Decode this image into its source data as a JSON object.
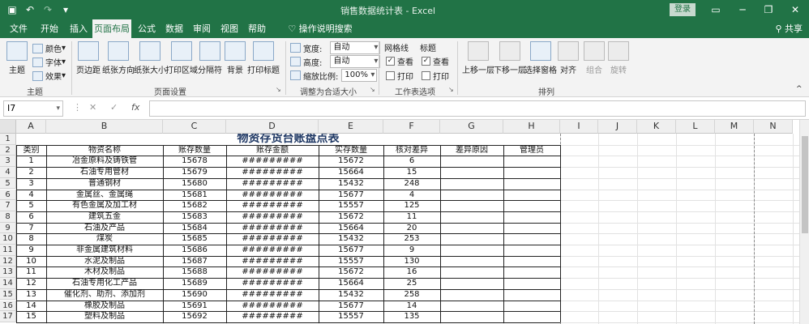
{
  "window": {
    "title": "销售数据统计表 - Excel",
    "login": "登录"
  },
  "tabs": [
    "文件",
    "开始",
    "插入",
    "页面布局",
    "公式",
    "数据",
    "审阅",
    "视图",
    "帮助",
    "操作说明搜索"
  ],
  "share": "共享",
  "ribbon": {
    "theme": {
      "main": "主题",
      "colors": "颜色",
      "fonts": "字体",
      "effects": "效果",
      "group": "主题"
    },
    "page_setup": {
      "margins": "页边距",
      "orientation": "纸张方向",
      "size": "纸张大小",
      "print_area": "打印区域",
      "breaks": "分隔符",
      "background": "背景",
      "print_titles": "打印标题",
      "group": "页面设置"
    },
    "scale": {
      "width_label": "宽度:",
      "width_value": "自动",
      "height_label": "高度:",
      "height_value": "自动",
      "scale_label": "缩放比例:",
      "scale_value": "100%",
      "group": "调整为合适大小"
    },
    "sheet_options": {
      "gridlines": "网格线",
      "headings": "标题",
      "view1": "查看",
      "view2": "查看",
      "print1": "打印",
      "print2": "打印",
      "group": "工作表选项"
    },
    "arrange": {
      "forward": "上移一层",
      "backward": "下移一层",
      "selection": "选择窗格",
      "align": "对齐",
      "group_btn": "组合",
      "rotate": "旋转",
      "group": "排列"
    }
  },
  "formula_bar": {
    "name_box": "I7",
    "fx": "fx",
    "value": ""
  },
  "columns": [
    "A",
    "B",
    "C",
    "D",
    "E",
    "F",
    "G",
    "H",
    "I",
    "J",
    "K",
    "L",
    "M",
    "N"
  ],
  "sheet": {
    "title": "物资存货台账盘点表",
    "headers": [
      "类别",
      "物资名称",
      "账存数量",
      "账存金额",
      "实存数量",
      "核对差异",
      "差异原因",
      "管理员"
    ],
    "rows": [
      {
        "row": "3",
        "cells": [
          "1",
          "冶金原料及铸铁管",
          "15678",
          "#########",
          "15672",
          "6",
          "",
          ""
        ]
      },
      {
        "row": "4",
        "cells": [
          "2",
          "石油专用管材",
          "15679",
          "#########",
          "15664",
          "15",
          "",
          ""
        ]
      },
      {
        "row": "5",
        "cells": [
          "3",
          "普通钢材",
          "15680",
          "#########",
          "15432",
          "248",
          "",
          ""
        ]
      },
      {
        "row": "6",
        "cells": [
          "4",
          "金属丝、金属绳",
          "15681",
          "#########",
          "15677",
          "4",
          "",
          ""
        ]
      },
      {
        "row": "7",
        "cells": [
          "5",
          "有色金属及加工材",
          "15682",
          "#########",
          "15557",
          "125",
          "",
          ""
        ]
      },
      {
        "row": "8",
        "cells": [
          "6",
          "建筑五金",
          "15683",
          "#########",
          "15672",
          "11",
          "",
          ""
        ]
      },
      {
        "row": "9",
        "cells": [
          "7",
          "石油及产品",
          "15684",
          "#########",
          "15664",
          "20",
          "",
          ""
        ]
      },
      {
        "row": "10",
        "cells": [
          "8",
          "煤炭",
          "15685",
          "#########",
          "15432",
          "253",
          "",
          ""
        ]
      },
      {
        "row": "11",
        "cells": [
          "9",
          "非金属建筑材料",
          "15686",
          "#########",
          "15677",
          "9",
          "",
          ""
        ]
      },
      {
        "row": "12",
        "cells": [
          "10",
          "水泥及制品",
          "15687",
          "#########",
          "15557",
          "130",
          "",
          ""
        ]
      },
      {
        "row": "13",
        "cells": [
          "11",
          "木材及制品",
          "15688",
          "#########",
          "15672",
          "16",
          "",
          ""
        ]
      },
      {
        "row": "14",
        "cells": [
          "12",
          "石油专用化工产品",
          "15689",
          "#########",
          "15664",
          "25",
          "",
          ""
        ]
      },
      {
        "row": "15",
        "cells": [
          "13",
          "催化剂、助剂、添加剂",
          "15690",
          "#########",
          "15432",
          "258",
          "",
          ""
        ]
      },
      {
        "row": "16",
        "cells": [
          "14",
          "橡胶及制品",
          "15691",
          "#########",
          "15677",
          "14",
          "",
          ""
        ]
      },
      {
        "row": "17",
        "cells": [
          "15",
          "塑料及制品",
          "15692",
          "#########",
          "15557",
          "135",
          "",
          ""
        ]
      }
    ]
  }
}
